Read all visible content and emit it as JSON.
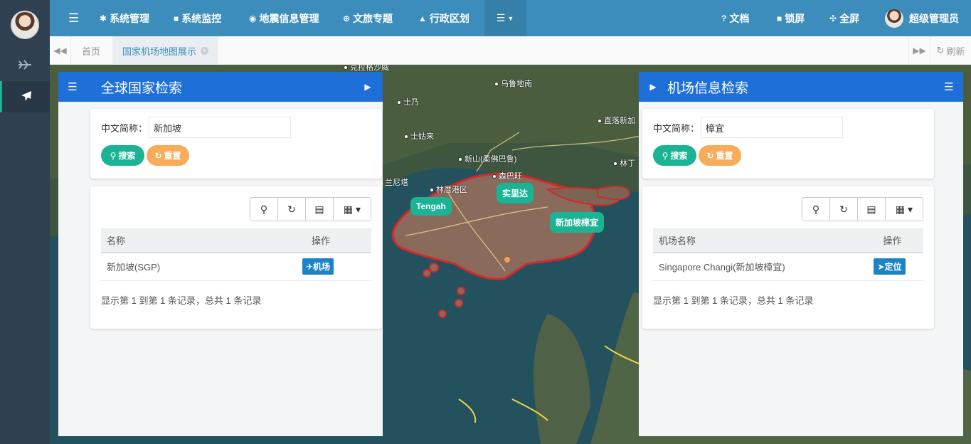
{
  "topnav": {
    "menus": [
      {
        "icon": "gear-icon",
        "label": "系统管理"
      },
      {
        "icon": "video-camera-icon",
        "label": "系统监控"
      },
      {
        "icon": "map-pin-icon",
        "label": "地震信息管理"
      },
      {
        "icon": "globe-icon",
        "label": "文旅专题"
      },
      {
        "icon": "bank-icon",
        "label": "行政区划"
      }
    ],
    "docs": "文档",
    "lock": "锁屏",
    "fullscreen": "全屏",
    "user": "超级管理员"
  },
  "tabs": {
    "home": "首页",
    "active": "国家机场地图展示",
    "refresh": "刷新"
  },
  "map": {
    "labels": [
      "克拉格沙威",
      "乌鲁地南",
      "士乃",
      "直落新加",
      "士姑来",
      "新山(柔佛巴鲁)",
      "森巴旺",
      "林丁",
      "兰尼塔",
      "林厝港区"
    ],
    "markers": [
      "Tengah",
      "实里达",
      "新加坡樟宜"
    ]
  },
  "left_panel": {
    "title": "全球国家检索",
    "field_label": "中文简称：",
    "field_value": "新加坡",
    "search_btn": "搜索",
    "reset_btn": "重置",
    "columns": [
      "名称",
      "操作"
    ],
    "rows": [
      {
        "name": "新加坡(SGP)",
        "action": "机场"
      }
    ],
    "pager": "显示第 1 到第 1 条记录，总共 1 条记录"
  },
  "right_panel": {
    "title": "机场信息检索",
    "field_label": "中文简称：",
    "field_value": "樟宜",
    "search_btn": "搜索",
    "reset_btn": "重置",
    "columns": [
      "机场名称",
      "操作"
    ],
    "rows": [
      {
        "name": "Singapore Changi(新加坡樟宜)",
        "action": "定位"
      }
    ],
    "pager": "显示第 1 到第 1 条记录，总共 1 条记录"
  },
  "colors": {
    "navbar": "#3c8dbc",
    "panel_header": "#1e6fd8",
    "primary": "#1ab394",
    "warning": "#f8ac59",
    "info_btn": "#1c84c6",
    "boundary": "#d9262b"
  }
}
